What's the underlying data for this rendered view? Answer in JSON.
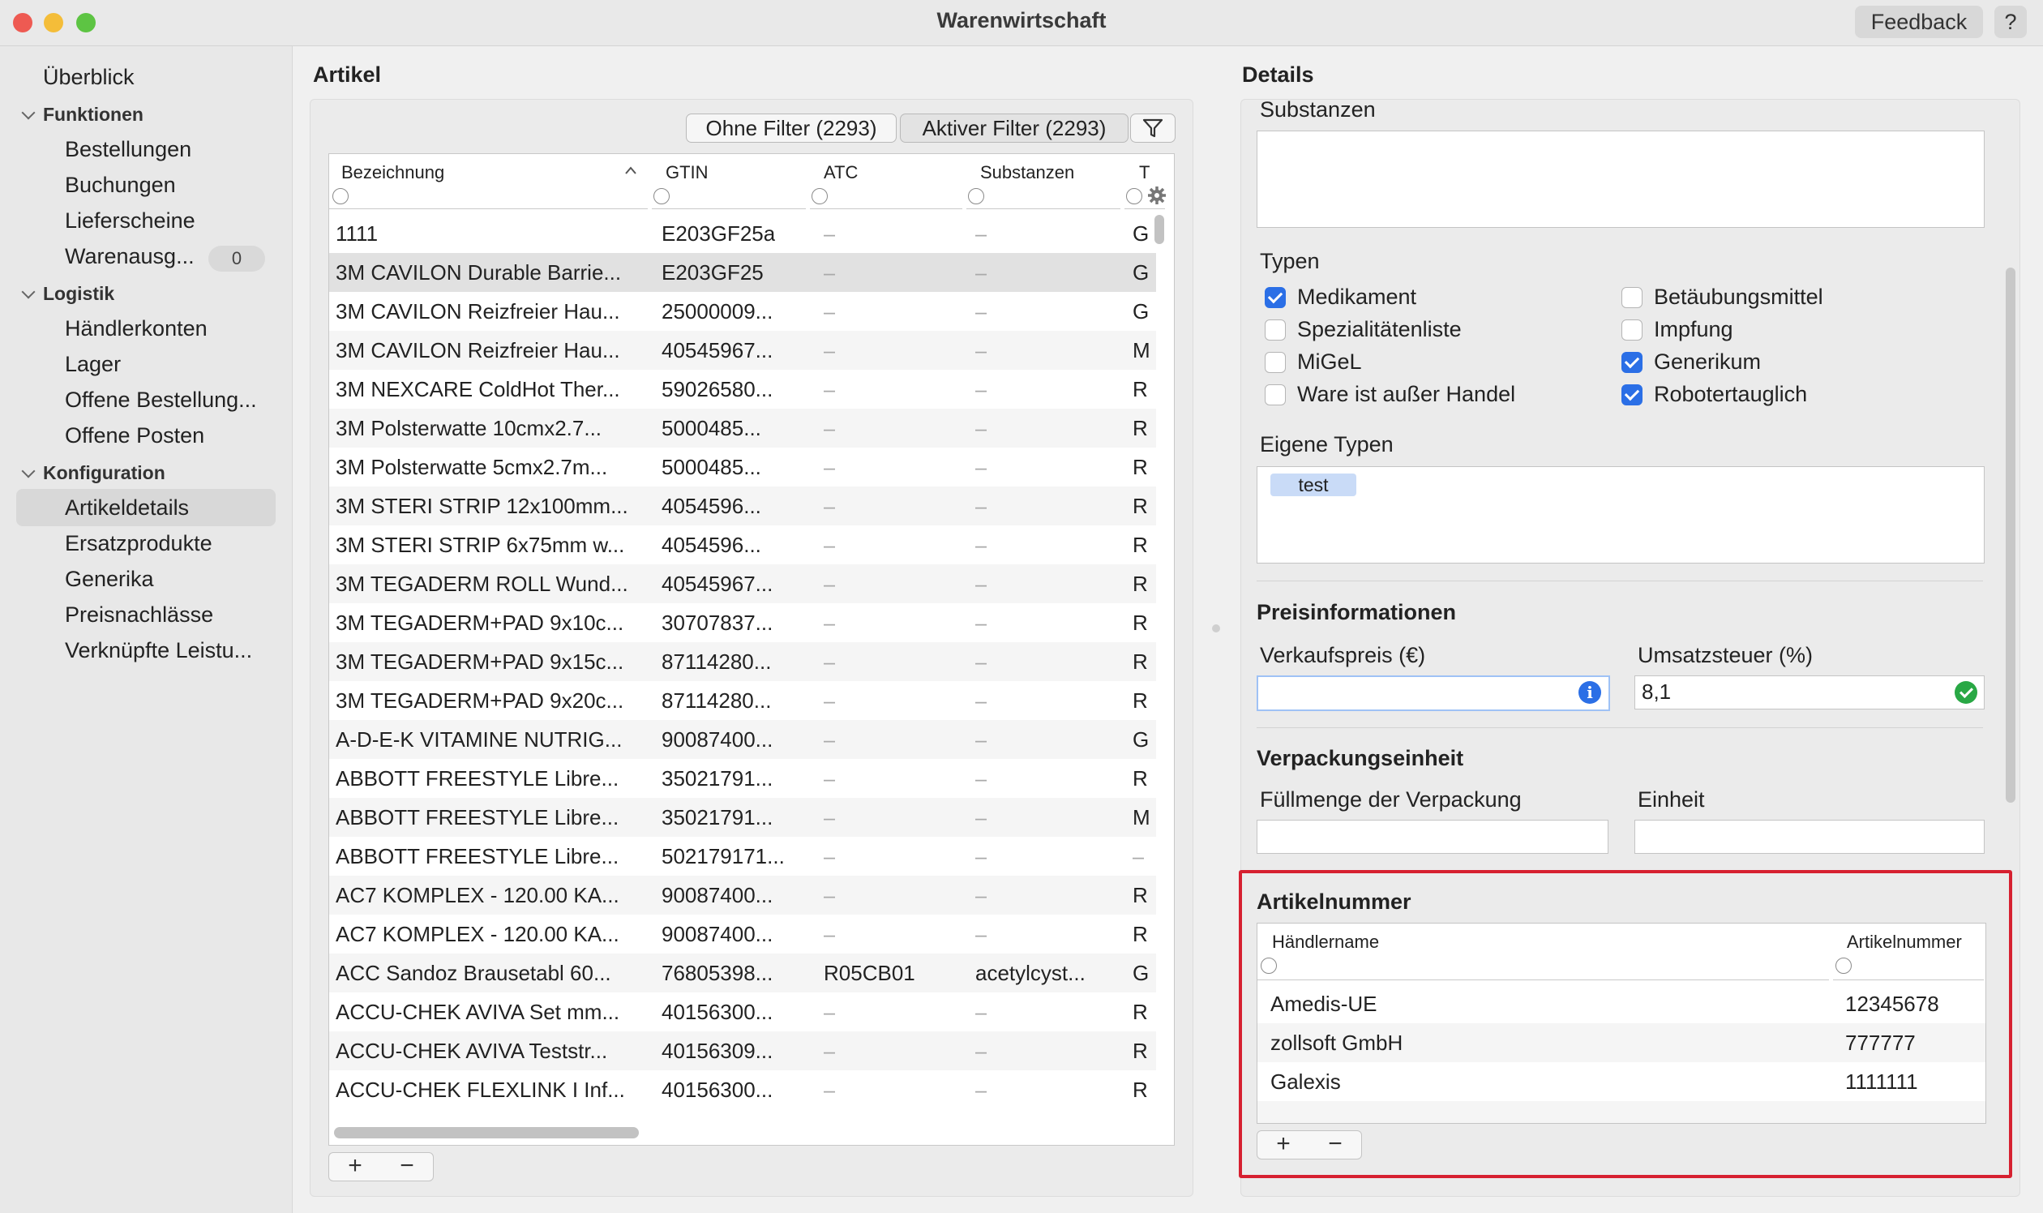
{
  "window": {
    "title": "Warenwirtschaft",
    "feedback": "Feedback",
    "help": "?"
  },
  "sidebar": {
    "overview": "Überblick",
    "groups": [
      {
        "label": "Funktionen",
        "items": [
          "Bestellungen",
          "Buchungen",
          "Lieferscheine",
          "Warenausg..."
        ]
      },
      {
        "label": "Logistik",
        "items": [
          "Händlerkonten",
          "Lager",
          "Offene Bestellung...",
          "Offene Posten"
        ]
      },
      {
        "label": "Konfiguration",
        "items": [
          "Artikeldetails",
          "Ersatzprodukte",
          "Generika",
          "Preisnachlässe",
          "Verknüpfte Leistu..."
        ]
      }
    ],
    "warenausgabe_badge": "0",
    "selected": "Artikeldetails"
  },
  "artikel": {
    "title": "Artikel",
    "filter_none": "Ohne Filter (2293)",
    "filter_active": "Aktiver Filter (2293)",
    "columns": [
      "Bezeichnung",
      "GTIN",
      "ATC",
      "Substanzen",
      "T"
    ],
    "rows": [
      [
        "1111",
        "E203GF25a",
        "–",
        "–",
        "G"
      ],
      [
        "3M CAVILON Durable Barrie...",
        "E203GF25",
        "–",
        "–",
        "G"
      ],
      [
        "3M CAVILON Reizfreier Hau...",
        "25000009...",
        "–",
        "–",
        "G"
      ],
      [
        "3M CAVILON Reizfreier Hau...",
        "40545967...",
        "–",
        "–",
        "M"
      ],
      [
        "3M NEXCARE ColdHot Ther...",
        "59026580...",
        "–",
        "–",
        "R"
      ],
      [
        "3M Polsterwatte 10cmx2.7...",
        "5000485...",
        "–",
        "–",
        "R"
      ],
      [
        "3M Polsterwatte 5cmx2.7m...",
        "5000485...",
        "–",
        "–",
        "R"
      ],
      [
        "3M STERI STRIP 12x100mm...",
        "4054596...",
        "–",
        "–",
        "R"
      ],
      [
        "3M STERI STRIP 6x75mm w...",
        "4054596...",
        "–",
        "–",
        "R"
      ],
      [
        "3M TEGADERM ROLL Wund...",
        "40545967...",
        "–",
        "–",
        "R"
      ],
      [
        "3M TEGADERM+PAD 9x10c...",
        "30707837...",
        "–",
        "–",
        "R"
      ],
      [
        "3M TEGADERM+PAD 9x15c...",
        "87114280...",
        "–",
        "–",
        "R"
      ],
      [
        "3M TEGADERM+PAD 9x20c...",
        "87114280...",
        "–",
        "–",
        "R"
      ],
      [
        "A-D-E-K VITAMINE NUTRIG...",
        "90087400...",
        "–",
        "–",
        "G"
      ],
      [
        "ABBOTT FREESTYLE Libre...",
        "35021791...",
        "–",
        "–",
        "R"
      ],
      [
        "ABBOTT FREESTYLE Libre...",
        "35021791...",
        "–",
        "–",
        "M"
      ],
      [
        "ABBOTT FREESTYLE Libre...",
        "502179171...",
        "–",
        "–",
        "–"
      ],
      [
        "AC7 KOMPLEX - 120.00 KA...",
        "90087400...",
        "–",
        "–",
        "R"
      ],
      [
        "AC7 KOMPLEX - 120.00 KA...",
        "90087400...",
        "–",
        "–",
        "R"
      ],
      [
        "ACC Sandoz Brausetabl 60...",
        "76805398...",
        "R05CB01",
        "acetylcyst...",
        "G"
      ],
      [
        "ACCU-CHEK AVIVA Set mm...",
        "40156300...",
        "–",
        "–",
        "R"
      ],
      [
        "ACCU-CHEK AVIVA Teststr...",
        "40156309...",
        "–",
        "–",
        "R"
      ],
      [
        "ACCU-CHEK FLEXLINK I Inf...",
        "40156300...",
        "–",
        "–",
        "R"
      ]
    ],
    "add": "+",
    "remove": "−"
  },
  "details": {
    "title": "Details",
    "substanzen_label": "Substanzen",
    "typen_label": "Typen",
    "typen": [
      {
        "label": "Medikament",
        "checked": true
      },
      {
        "label": "Spezialitätenliste",
        "checked": false
      },
      {
        "label": "MiGeL",
        "checked": false
      },
      {
        "label": "Ware ist außer Handel",
        "checked": false
      },
      {
        "label": "Betäubungsmittel",
        "checked": false
      },
      {
        "label": "Impfung",
        "checked": false
      },
      {
        "label": "Generikum",
        "checked": true
      },
      {
        "label": "Robotertauglich",
        "checked": true
      }
    ],
    "eigene_typen_label": "Eigene Typen",
    "eigene_typen_tag": "test",
    "preis_title": "Preisinformationen",
    "verkaufspreis_label": "Verkaufspreis (€)",
    "verkaufspreis_value": "",
    "ust_label": "Umsatzsteuer (%)",
    "ust_value": "8,1",
    "verpackung_title": "Verpackungseinheit",
    "fuellmenge_label": "Füllmenge der Verpackung",
    "einheit_label": "Einheit",
    "artikelnummer_title": "Artikelnummer",
    "sub_columns": [
      "Händlername",
      "Artikelnummer"
    ],
    "sub_rows": [
      [
        "Amedis-UE",
        "12345678"
      ],
      [
        "zollsoft GmbH",
        "777777"
      ],
      [
        "Galexis",
        "1111111"
      ]
    ],
    "add": "+",
    "remove": "−"
  },
  "colors": {
    "accent": "#2b6fe6",
    "highlight": "#d62030",
    "success": "#29a845"
  }
}
